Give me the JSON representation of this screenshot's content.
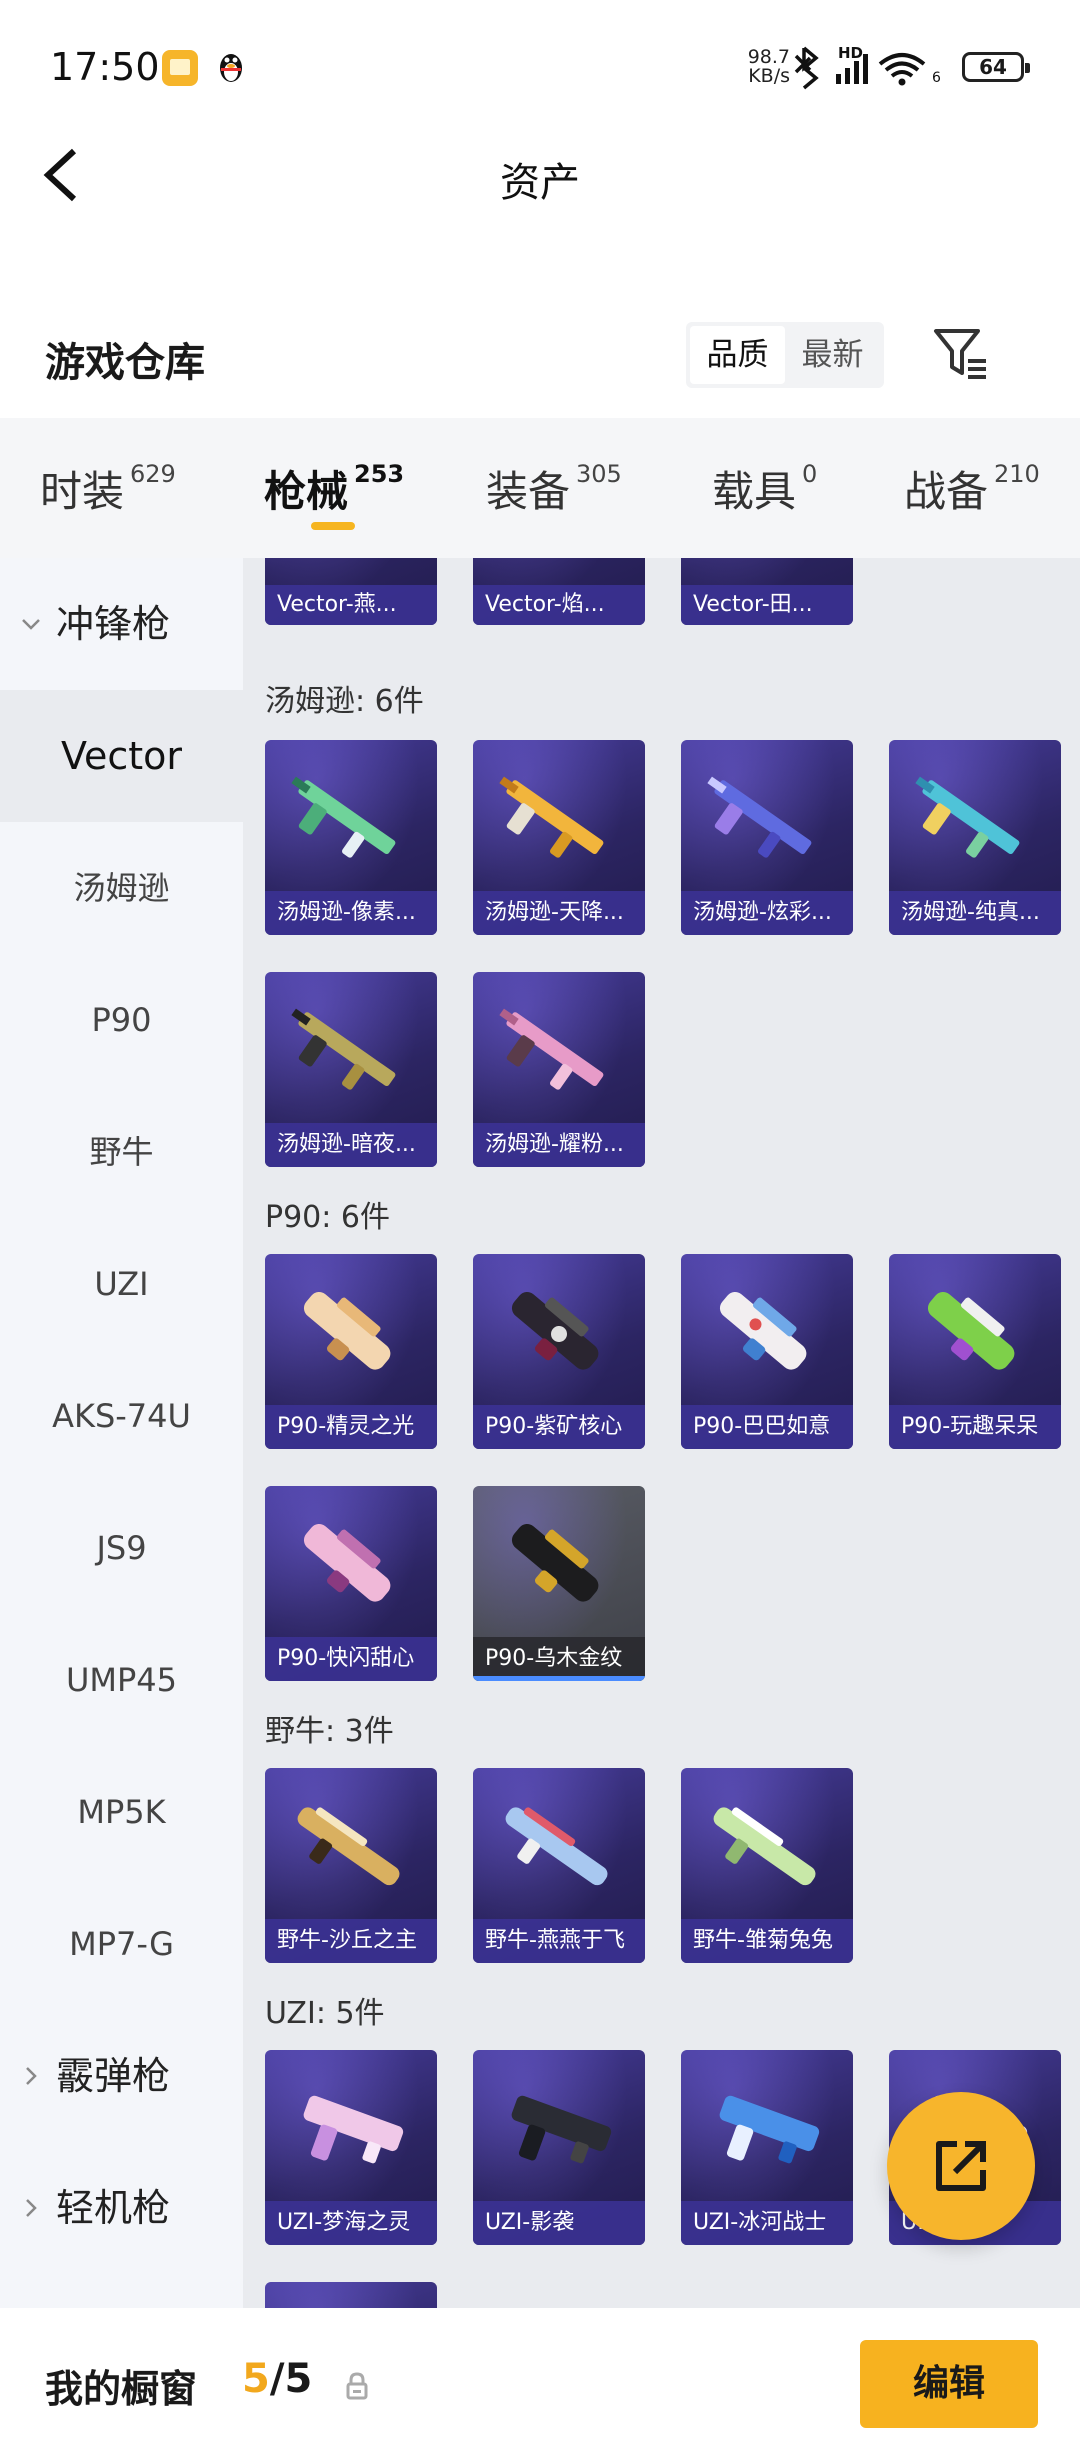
{
  "status_bar": {
    "time": "17:50",
    "net_speed_value": "98.7",
    "net_speed_unit": "KB/s",
    "signal_label": "HD",
    "wifi_label": "6",
    "battery": "64"
  },
  "header": {
    "title": "资产"
  },
  "section": {
    "title": "游戏仓库",
    "sort_options": [
      "品质",
      "最新"
    ],
    "sort_active": "品质"
  },
  "tabs": [
    {
      "label": "时装",
      "count": "629"
    },
    {
      "label": "枪械",
      "count": "253",
      "active": true
    },
    {
      "label": "装备",
      "count": "305"
    },
    {
      "label": "载具",
      "count": "0"
    },
    {
      "label": "战备",
      "count": "210"
    }
  ],
  "sidebar": {
    "group_smg": "冲锋枪",
    "items": [
      "Vector",
      "汤姆逊",
      "P90",
      "野牛",
      "UZI",
      "AKS-74U",
      "JS9",
      "UMP45",
      "MP5K",
      "MP7-G"
    ],
    "active": "Vector",
    "group_shotgun": "霰弹枪",
    "group_lmg": "轻机枪"
  },
  "content": {
    "vector_cards": [
      "Vector-燕...",
      "Vector-焰...",
      "Vector-田..."
    ],
    "thompson": {
      "title": "汤姆逊: 6件",
      "cards": [
        "汤姆逊-像素...",
        "汤姆逊-天降...",
        "汤姆逊-炫彩...",
        "汤姆逊-纯真...",
        "汤姆逊-暗夜...",
        "汤姆逊-耀粉..."
      ]
    },
    "p90": {
      "title": "P90: 6件",
      "cards": [
        "P90-精灵之光",
        "P90-紫矿核心",
        "P90-巴巴如意",
        "P90-玩趣呆呆",
        "P90-快闪甜心",
        "P90-乌木金纹"
      ]
    },
    "bison": {
      "title": "野牛: 3件",
      "cards": [
        "野牛-沙丘之主",
        "野牛-燕燕于飞",
        "野牛-雏菊兔兔"
      ]
    },
    "uzi": {
      "title": "UZI: 5件",
      "cards": [
        "UZI-梦海之灵",
        "UZI-影袭",
        "UZI-冰河战士",
        "U...啾咪"
      ]
    }
  },
  "bottom_bar": {
    "label": "我的橱窗",
    "count_current": "5",
    "count_sep_total": "/5",
    "edit_label": "编辑"
  },
  "colors": {
    "accent": "#f7b21f",
    "card_bg": "#2c2563",
    "card_label_bg": "#3c3296",
    "content_bg": "#e9ebef",
    "sidebar_bg": "#f4f6fa"
  }
}
